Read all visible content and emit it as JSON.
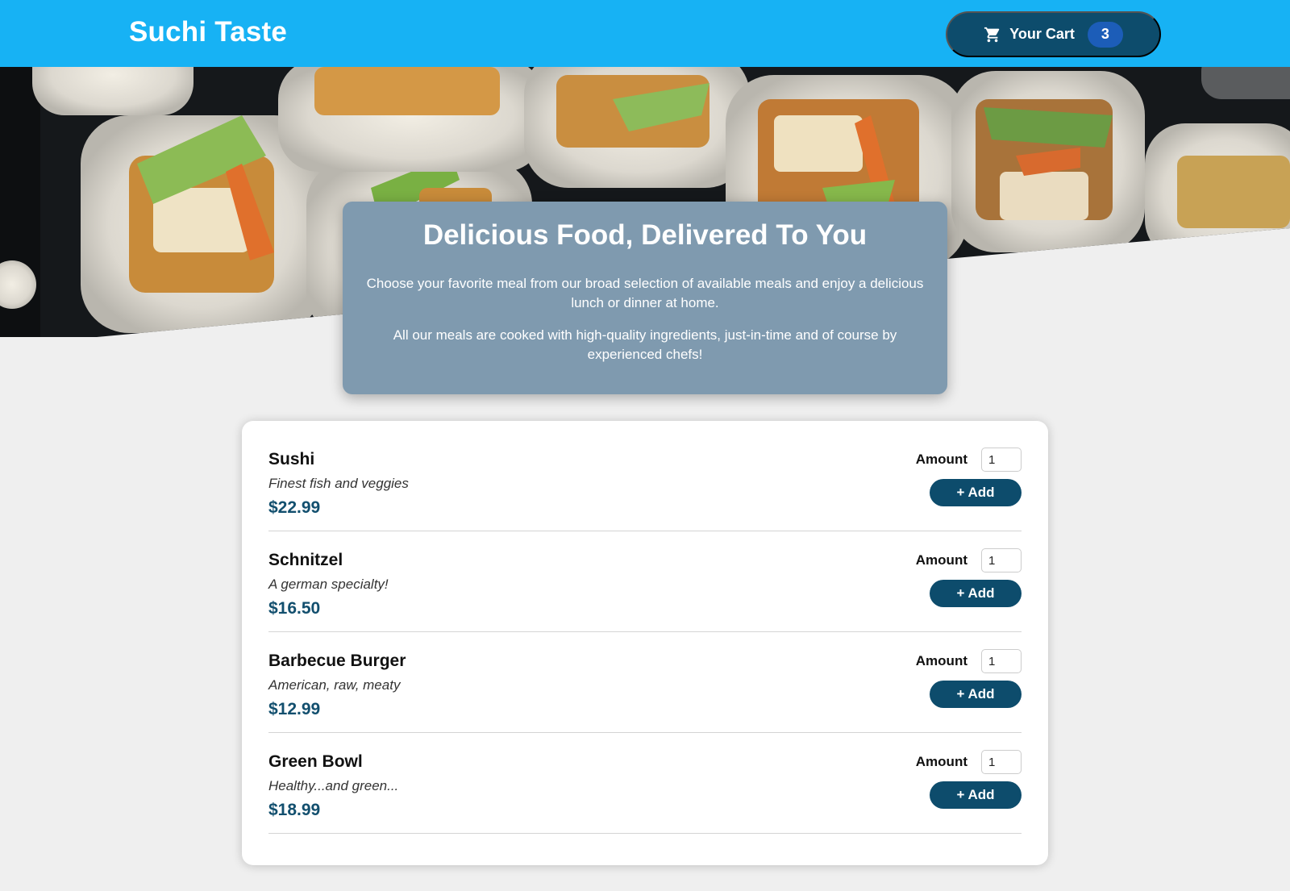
{
  "header": {
    "brand": "Suchi Taste",
    "cart": {
      "label": "Your Cart",
      "count": "3",
      "icon": "cart-icon"
    }
  },
  "colors": {
    "header_bg": "#17b2f4",
    "button_bg": "#0d4c6c",
    "badge_bg": "#1c5db8",
    "summary_bg": "#7f9aaf",
    "price": "#124f6e",
    "page_bg": "#efefef"
  },
  "summary": {
    "title": "Delicious Food, Delivered To You",
    "paragraph1": "Choose your favorite meal from our broad selection of available meals and enjoy a delicious lunch or dinner at home.",
    "paragraph2": "All our meals are cooked with high-quality ingredients, just-in-time and of course by experienced chefs!"
  },
  "meals": [
    {
      "name": "Sushi",
      "description": "Finest fish and veggies",
      "price": "$22.99",
      "amount_label": "Amount",
      "amount_value": "1",
      "add_label": "+ Add"
    },
    {
      "name": "Schnitzel",
      "description": "A german specialty!",
      "price": "$16.50",
      "amount_label": "Amount",
      "amount_value": "1",
      "add_label": "+ Add"
    },
    {
      "name": "Barbecue Burger",
      "description": "American, raw, meaty",
      "price": "$12.99",
      "amount_label": "Amount",
      "amount_value": "1",
      "add_label": "+ Add"
    },
    {
      "name": "Green Bowl",
      "description": "Healthy...and green...",
      "price": "$18.99",
      "amount_label": "Amount",
      "amount_value": "1",
      "add_label": "+ Add"
    }
  ]
}
